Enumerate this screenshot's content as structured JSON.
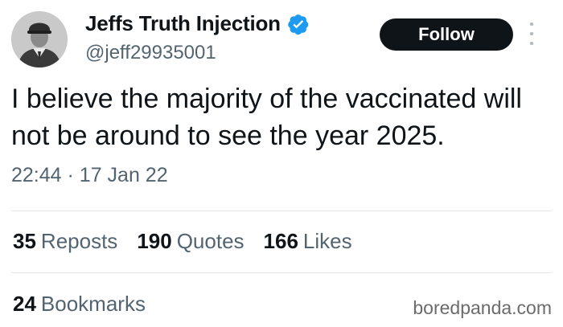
{
  "author": {
    "display_name": "Jeffs Truth Injection",
    "handle": "@jeff29935001",
    "verified": true
  },
  "actions": {
    "follow_label": "Follow"
  },
  "tweet": {
    "text": "I believe the majority of the vaccinated will not be around to see the year 2025.",
    "time": "22:44",
    "separator": "·",
    "date": "17 Jan 22"
  },
  "stats": {
    "reposts": {
      "count": "35",
      "label": "Reposts"
    },
    "quotes": {
      "count": "190",
      "label": "Quotes"
    },
    "likes": {
      "count": "166",
      "label": "Likes"
    },
    "bookmarks": {
      "count": "24",
      "label": "Bookmarks"
    }
  },
  "watermark": "boredpanda.com",
  "colors": {
    "text_primary": "#0f1419",
    "text_secondary": "#536471",
    "verified_blue": "#1d9bf0",
    "follow_bg": "#0f1419",
    "divider": "#e4e7ea"
  }
}
